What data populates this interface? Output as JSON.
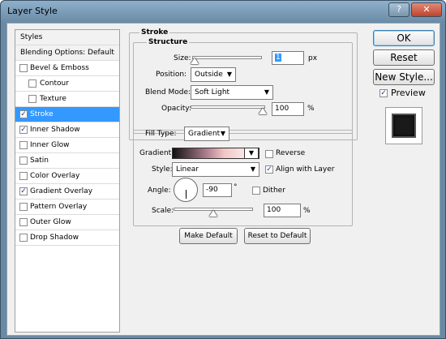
{
  "window": {
    "title": "Layer Style",
    "help_btn": "?",
    "close_btn": "✕"
  },
  "styles_list": {
    "header": "Styles",
    "blending": "Blending Options: Default",
    "items": [
      {
        "label": "Bevel & Emboss",
        "checked": false,
        "indent": false
      },
      {
        "label": "Contour",
        "checked": false,
        "indent": true
      },
      {
        "label": "Texture",
        "checked": false,
        "indent": true
      },
      {
        "label": "Stroke",
        "checked": true,
        "indent": false,
        "selected": true
      },
      {
        "label": "Inner Shadow",
        "checked": true,
        "indent": false
      },
      {
        "label": "Inner Glow",
        "checked": false,
        "indent": false
      },
      {
        "label": "Satin",
        "checked": false,
        "indent": false
      },
      {
        "label": "Color Overlay",
        "checked": false,
        "indent": false
      },
      {
        "label": "Gradient Overlay",
        "checked": true,
        "indent": false
      },
      {
        "label": "Pattern Overlay",
        "checked": false,
        "indent": false
      },
      {
        "label": "Outer Glow",
        "checked": false,
        "indent": false
      },
      {
        "label": "Drop Shadow",
        "checked": false,
        "indent": false
      }
    ]
  },
  "stroke": {
    "title": "Stroke",
    "structure_title": "Structure",
    "size_label": "Size:",
    "size_value": "1",
    "size_unit": "px",
    "position_label": "Position:",
    "position_value": "Outside",
    "blend_label": "Blend Mode:",
    "blend_value": "Soft Light",
    "opacity_label": "Opacity:",
    "opacity_value": "100",
    "opacity_unit": "%",
    "size_slider_level": 0.0,
    "opacity_slider_level": 1.0
  },
  "fill": {
    "filltype_label": "Fill Type:",
    "filltype_value": "Gradient",
    "gradient_label": "Gradient:",
    "reverse_label": "Reverse",
    "reverse_checked": false,
    "style_label": "Style:",
    "style_value": "Linear",
    "align_label": "Align with Layer",
    "align_checked": true,
    "angle_label": "Angle:",
    "angle_value": "-90",
    "angle_unit": "°",
    "dither_label": "Dither",
    "dither_checked": false,
    "scale_label": "Scale:",
    "scale_value": "100",
    "scale_unit": "%",
    "scale_slider_level": 0.5,
    "make_default": "Make Default",
    "reset_default": "Reset to Default"
  },
  "buttons": {
    "ok": "OK",
    "reset": "Reset",
    "new_style": "New Style...",
    "preview_label": "Preview",
    "preview_checked": true
  }
}
